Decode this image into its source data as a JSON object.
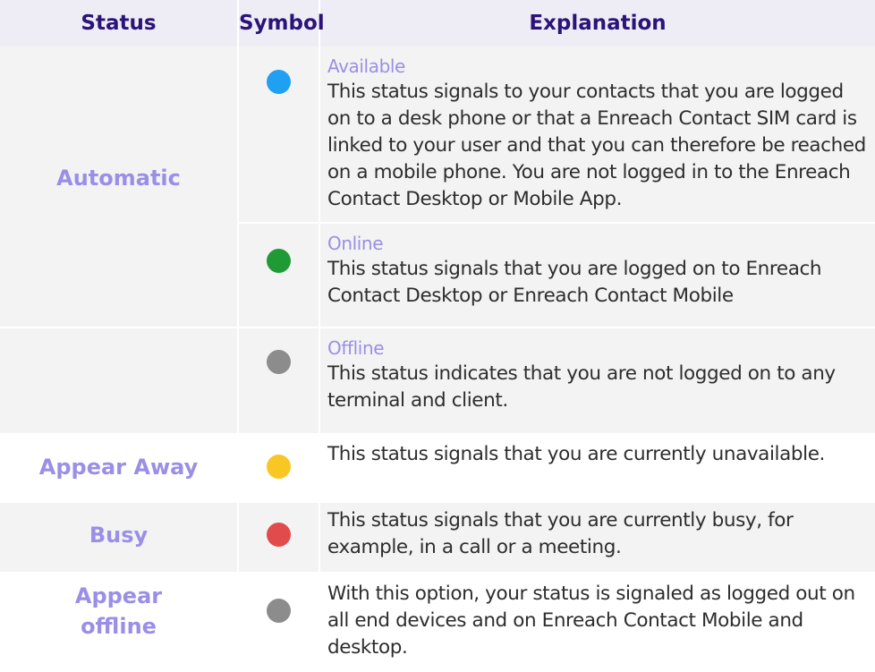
{
  "headers": {
    "status": "Status",
    "symbol": "Symbol",
    "explanation": "Explanation"
  },
  "colors": {
    "header_bg": "#eeedf6",
    "header_text": "#2b1379",
    "status_text": "#9a8fe6",
    "row_shade": "#f3f3f3",
    "blue": "#1fa0f2",
    "green": "#1f9a35",
    "gray": "#8c8c8c",
    "yellow": "#f8c723",
    "red": "#e24b4b"
  },
  "rows": [
    {
      "status": "Automatic",
      "symbol_icon": "blue-status-dot-icon",
      "title": "Available",
      "text": "This status signals to your contacts that you are logged on to a desk phone or that a Enreach Contact SIM card is linked to your user and that you can therefore be reached on a mobile phone. You are not logged in to the Enreach Contact Desktop or Mobile App."
    },
    {
      "status": "",
      "symbol_icon": "green-status-dot-icon",
      "title": "Online",
      "text": "This status signals that you are logged on to Enreach Contact Desktop or Enreach Contact Mobile"
    },
    {
      "status": "",
      "symbol_icon": "gray-status-dot-icon",
      "title": "Offline",
      "text": "This status indicates that you are not logged on to any terminal and client."
    },
    {
      "status": "Appear Away",
      "symbol_icon": "yellow-status-dot-icon",
      "title": "",
      "text": "This status signals that you are currently unavailable."
    },
    {
      "status": "Busy",
      "symbol_icon": "red-status-dot-icon",
      "title": "",
      "text": "This status signals that you are currently busy, for example, in a call or a meeting."
    },
    {
      "status": "Appear offline",
      "symbol_icon": "gray-status-dot-icon",
      "title": "",
      "text": "With this option, your status is signaled as logged out on all end devices and on Enreach Contact Mobile and desktop."
    }
  ]
}
